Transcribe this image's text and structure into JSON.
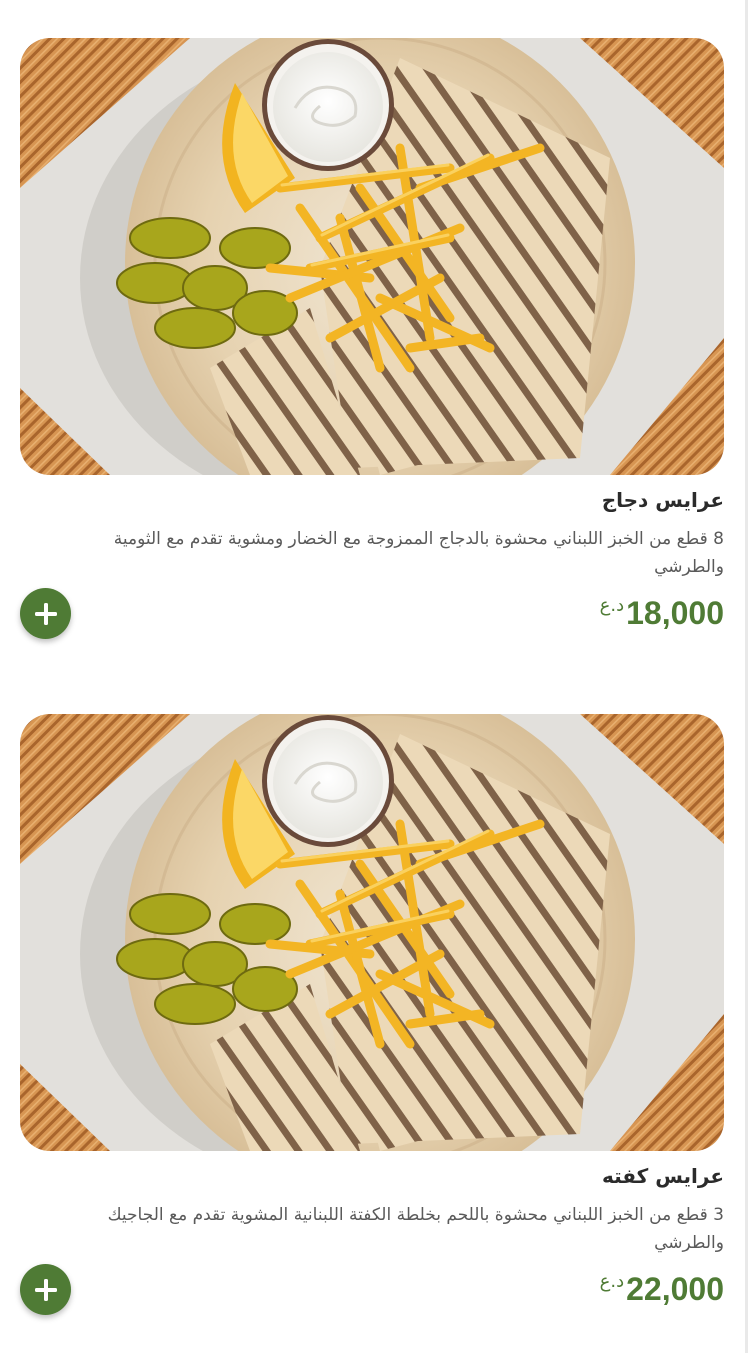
{
  "items": [
    {
      "image_alt": "plate of grilled arayes with fries, pickles, lemon and garlic sauce",
      "title": "عرايس دجاج",
      "description": "8 قطع من الخبز اللبناني محشوة بالدجاج الممزوجة مع الخضار ومشوية تقدم مع الثومية والطرشي",
      "price": "18,000",
      "currency": "د.ع",
      "add_icon": "plus-icon"
    },
    {
      "image_alt": "plate of grilled arayes with fries, pickles, lemon and garlic sauce",
      "title": "عرايس كفته",
      "description": "3 قطع من الخبز اللبناني محشوة باللحم بخلطة الكفتة اللبنانية المشوية تقدم مع الجاجيك والطرشي",
      "price": "22,000",
      "currency": "د.ع",
      "add_icon": "plus-icon"
    }
  ],
  "colors": {
    "accent": "#4f7b35",
    "title": "#2b2b2b",
    "description": "#5a5a5a"
  }
}
